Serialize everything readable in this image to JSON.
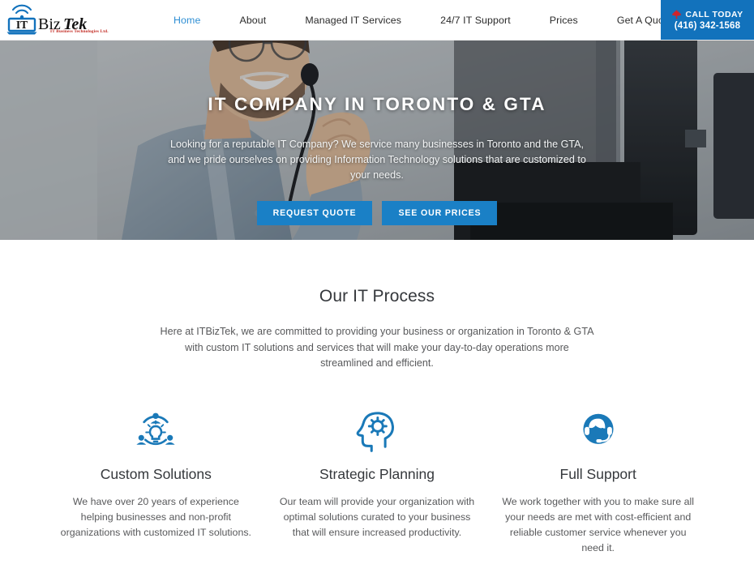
{
  "header": {
    "logo": {
      "text_it": "IT",
      "text_biz": "Biz",
      "text_tek": "Tek",
      "tagline": "IT Business Technologies Ltd.",
      "icon": "laptop-wifi-logo-icon"
    },
    "nav": [
      {
        "label": "Home",
        "active": true
      },
      {
        "label": "About",
        "active": false
      },
      {
        "label": "Managed IT Services",
        "active": false
      },
      {
        "label": "24/7 IT Support",
        "active": false
      },
      {
        "label": "Prices",
        "active": false
      },
      {
        "label": "Get A Quote",
        "active": false
      }
    ],
    "cta": {
      "icon": "maple-leaf-icon",
      "label": "CALL TODAY",
      "phone": "(416) 342-1568",
      "background": "#1272bc"
    }
  },
  "hero": {
    "title": "IT COMPANY IN TORONTO & GTA",
    "subtitle": "Looking for a reputable IT Company? We service many businesses in Toronto and the GTA, and we pride ourselves on providing Information Technology solutions that are customized to your needs.",
    "buttons": [
      {
        "label": "REQUEST QUOTE"
      },
      {
        "label": "SEE OUR PRICES"
      }
    ],
    "button_color": "#1a80c6",
    "image_description": "Smiling bearded man with glasses and headset at a desk with monitors"
  },
  "process": {
    "title": "Our IT Process",
    "description": "Here at ITBizTek, we are committed to providing your business or organization in Toronto & GTA with custom IT solutions and services that will make your day-to-day operations more streamlined and efficient."
  },
  "features": [
    {
      "icon": "team-collaboration-lightbulb-icon",
      "title": "Custom Solutions",
      "text": "We have over 20 years of experience helping businesses and non-profit organizations with customized IT solutions."
    },
    {
      "icon": "head-gear-strategy-icon",
      "title": "Strategic Planning",
      "text": "Our team will provide your organization with optimal solutions curated to your business that will ensure increased productivity."
    },
    {
      "icon": "headset-support-agent-icon",
      "title": "Full Support",
      "text": "We work together with you to make sure all your needs are met with cost-efficient and reliable customer service whenever you need it."
    }
  ],
  "colors": {
    "brand_blue": "#1272bc",
    "accent_blue": "#1a80c6",
    "nav_active": "#2f8fd4",
    "icon_blue": "#1a79b8",
    "leaf_red": "#d2232a",
    "body_text": "#58595b",
    "heading_text": "#35383c"
  }
}
